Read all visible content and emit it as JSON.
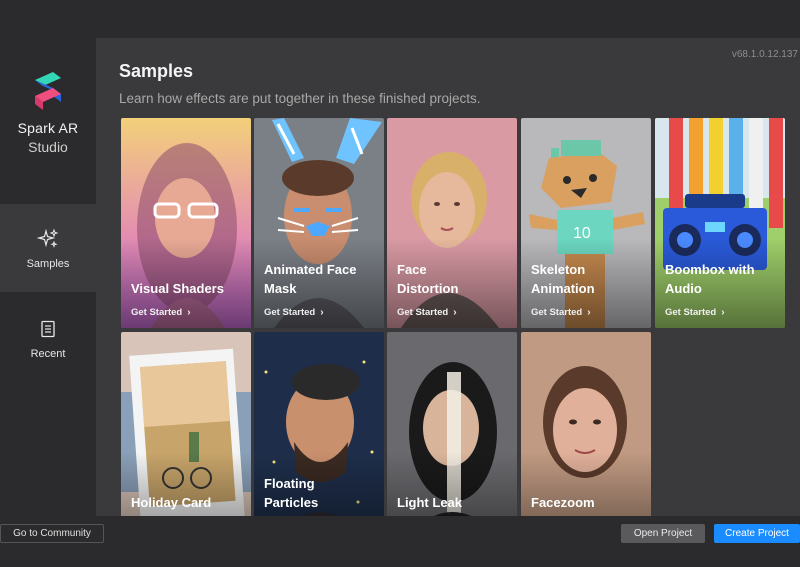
{
  "app": {
    "name_line1": "Spark AR",
    "name_line2": "Studio",
    "version": "v68.1.0.12.137"
  },
  "sidebar": {
    "items": [
      {
        "label": "Samples",
        "icon": "sparkle-icon",
        "active": true
      },
      {
        "label": "Recent",
        "icon": "document-icon",
        "active": false
      }
    ]
  },
  "main": {
    "title": "Samples",
    "subtitle": "Learn how effects are put together in these finished projects.",
    "cards": [
      {
        "title_lines": [
          "Visual Shaders"
        ],
        "cta": "Get Started",
        "chevron": "›"
      },
      {
        "title_lines": [
          "Animated Face",
          "Mask"
        ],
        "cta": "Get Started",
        "chevron": "›"
      },
      {
        "title_lines": [
          "Face",
          "Distortion"
        ],
        "cta": "Get Started",
        "chevron": "›"
      },
      {
        "title_lines": [
          "Skeleton",
          "Animation"
        ],
        "cta": "Get Started",
        "chevron": "›"
      },
      {
        "title_lines": [
          "Boombox with",
          "Audio"
        ],
        "cta": "Get Started",
        "chevron": "›"
      },
      {
        "title_lines": [
          "Holiday Card"
        ]
      },
      {
        "title_lines": [
          "Floating",
          "Particles"
        ]
      },
      {
        "title_lines": [
          "Light Leak"
        ]
      },
      {
        "title_lines": [
          "Facezoom"
        ]
      }
    ]
  },
  "footer": {
    "community_label": "Go to Community",
    "open_label": "Open Project",
    "create_label": "Create Project"
  },
  "colors": {
    "accent": "#1a8cff",
    "background": "#2b2b2d",
    "panel": "#3a3a3c"
  }
}
